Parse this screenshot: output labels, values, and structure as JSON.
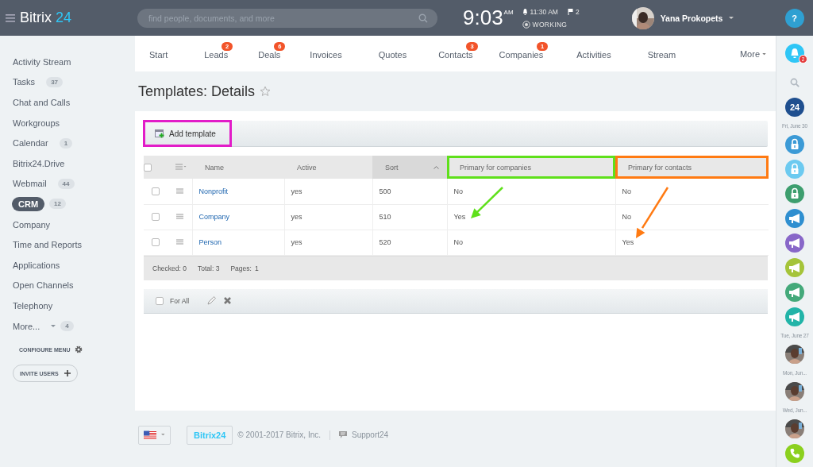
{
  "header": {
    "logo": {
      "name": "Bitrix",
      "number": "24"
    },
    "search": {
      "placeholder": "find people, documents, and more"
    },
    "clock": {
      "time": "9:03",
      "ampm": "AM"
    },
    "alarm": "11:30 AM",
    "flags": "2",
    "status": "WORKING",
    "user": "Yana Prokopets"
  },
  "nav": [
    {
      "label": "Start"
    },
    {
      "label": "Leads",
      "badge": "2"
    },
    {
      "label": "Deals",
      "badge": "6"
    },
    {
      "label": "Invoices"
    },
    {
      "label": "Quotes"
    },
    {
      "label": "Contacts",
      "badge": "3"
    },
    {
      "label": "Companies",
      "badge": "1"
    },
    {
      "label": "Activities"
    },
    {
      "label": "Stream"
    }
  ],
  "nav_more": "More",
  "sidebar": {
    "items": [
      {
        "label": "Activity Stream",
        "selected": false
      },
      {
        "label": "Tasks",
        "count": "37",
        "selected": false
      },
      {
        "label": "Chat and Calls",
        "selected": false
      },
      {
        "label": "Workgroups",
        "selected": false
      },
      {
        "label": "Calendar",
        "count": "1",
        "selected": false
      },
      {
        "label": "Bitrix24.Drive",
        "selected": false
      },
      {
        "label": "Webmail",
        "count": "44",
        "selected": false
      },
      {
        "label": "CRM",
        "count": "12",
        "selected": true
      },
      {
        "label": "Company",
        "selected": false
      },
      {
        "label": "Time and Reports",
        "selected": false
      },
      {
        "label": "Applications",
        "selected": false
      },
      {
        "label": "Open Channels",
        "selected": false
      },
      {
        "label": "Telephony",
        "selected": false
      },
      {
        "label": "More...",
        "count": "4",
        "selected": false,
        "dropdown": true
      }
    ],
    "configure": "CONFIGURE MENU",
    "invite": "INVITE USERS"
  },
  "page_title": "Templates: Details",
  "add_button": {
    "label": "Add template",
    "color": "#e21cc8"
  },
  "table": {
    "select_all_checked": false,
    "columns": [
      {
        "label": "Name",
        "sorted": false
      },
      {
        "label": "Active",
        "sorted": false
      },
      {
        "label": "Sort",
        "sorted": true
      },
      {
        "label": "Primary for companies",
        "sorted": false,
        "color": "#5fe01b"
      },
      {
        "label": "Primary for contacts",
        "sorted": false,
        "color": "#ff7a12"
      }
    ],
    "rows": [
      {
        "checked": false,
        "name": "Nonprofit",
        "active": "yes",
        "sort": "500",
        "companies": "No",
        "contacts": "No"
      },
      {
        "checked": false,
        "name": "Company",
        "active": "yes",
        "sort": "510",
        "companies": "Yes",
        "contacts": "No"
      },
      {
        "checked": false,
        "name": "Person",
        "active": "yes",
        "sort": "520",
        "companies": "No",
        "contacts": "Yes"
      }
    ],
    "footer": {
      "checked": "Checked: 0",
      "total": "Total: 3",
      "pages_label": "Pages:",
      "pages": "1"
    }
  },
  "actions": {
    "for_all": "For All",
    "checked": false
  },
  "annotations": [
    {
      "kind": "arrow",
      "color": "#5fe01b"
    },
    {
      "kind": "arrow",
      "color": "#ff7a12"
    }
  ],
  "footer": {
    "logo": "Bitrix24",
    "copyright": "© 2001-2017 Bitrix, Inc.",
    "support": "Support24"
  },
  "right_bar": [
    {
      "kind": "help",
      "label": "?"
    },
    {
      "kind": "bell",
      "badge": "2"
    },
    {
      "kind": "search"
    },
    {
      "kind": "logo",
      "label": "24"
    },
    {
      "kind": "date",
      "label": "Fri, June 30"
    },
    {
      "kind": "lock",
      "color": "#3b9ad6"
    },
    {
      "kind": "lock",
      "color": "#6ccaf0"
    },
    {
      "kind": "lock",
      "color": "#3d9e6e"
    },
    {
      "kind": "megaphone",
      "color": "#2f8fd0"
    },
    {
      "kind": "megaphone",
      "color": "#8867c8"
    },
    {
      "kind": "megaphone",
      "color": "#a5c43a"
    },
    {
      "kind": "megaphone",
      "color": "#44a97a"
    },
    {
      "kind": "megaphone",
      "color": "#22b4a8"
    },
    {
      "kind": "date",
      "label": "Tue, June 27"
    },
    {
      "kind": "avatar"
    },
    {
      "kind": "date",
      "label": "Mon, Jun..."
    },
    {
      "kind": "avatar"
    },
    {
      "kind": "date",
      "label": "Wed, Jun..."
    },
    {
      "kind": "avatar"
    },
    {
      "kind": "phone",
      "color": "#8bd01e"
    }
  ]
}
